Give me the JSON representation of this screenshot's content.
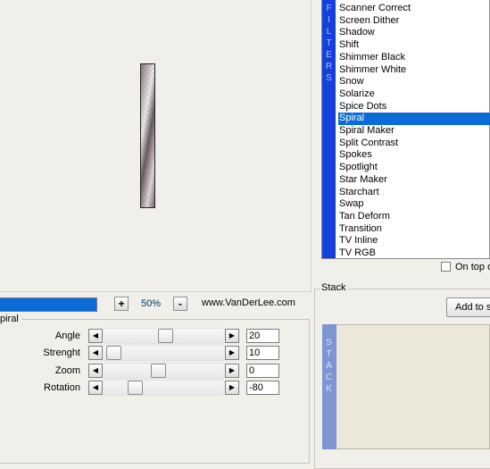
{
  "filters": {
    "strip_letters": [
      "F",
      "I",
      "L",
      "T",
      "E",
      "R",
      "S"
    ],
    "items": [
      "Scanner Correct",
      "Screen Dither",
      "Shadow",
      "Shift",
      "Shimmer Black",
      "Shimmer White",
      "Snow",
      "Solarize",
      "Spice Dots",
      "Spiral",
      "Spiral Maker",
      "Split Contrast",
      "Spokes",
      "Spotlight",
      "Star Maker",
      "Starchart",
      "Swap",
      "Tan Deform",
      "Transition",
      "TV Inline",
      "TV RGB"
    ],
    "selected": "Spiral",
    "on_top_label": "On top o"
  },
  "toolbar": {
    "zoom_in": "+",
    "zoom_level": "50%",
    "zoom_out": "-",
    "website": "www.VanDerLee.com",
    "progress": 1.0
  },
  "spiral": {
    "title": "piral",
    "params": [
      {
        "label": "Angle",
        "value": "20",
        "slider": 0.52
      },
      {
        "label": "Strenght",
        "value": "10",
        "slider": 0.0
      },
      {
        "label": "Zoom",
        "value": "0",
        "slider": 0.45
      },
      {
        "label": "Rotation",
        "value": "-80",
        "slider": 0.22
      }
    ]
  },
  "stack": {
    "title": "Stack",
    "add_label": "Add to s",
    "strip_letters": [
      "S",
      "T",
      "A",
      "C",
      "K"
    ]
  },
  "colors": {
    "selection": "#0a6cd6",
    "filters_strip": "#1441d9",
    "stack_strip": "#7c96d4"
  }
}
